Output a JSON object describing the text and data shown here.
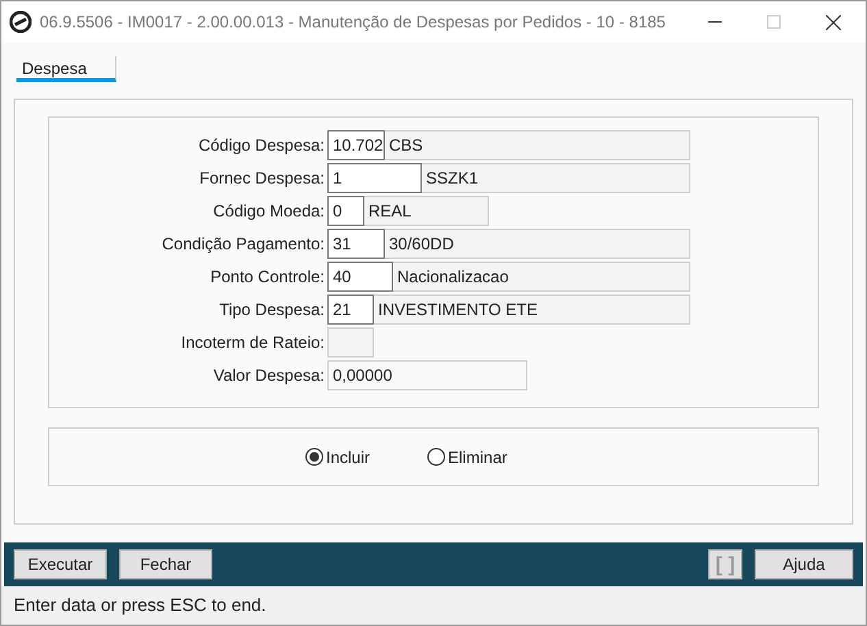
{
  "window": {
    "title": "06.9.5506 - IM0017 - 2.00.00.013 - Manutenção de Despesas por Pedidos - 10 - 8185"
  },
  "tabs": [
    {
      "label": "Despesa",
      "selected": true
    }
  ],
  "fields": [
    {
      "kind": "code_desc",
      "label": "Código Despesa:",
      "code": "10.702",
      "description": "CBS"
    },
    {
      "kind": "code_desc",
      "label": "Fornec Despesa:",
      "code": "1",
      "description": "SSZK1"
    },
    {
      "kind": "code_desc",
      "label": "Código Moeda:",
      "code": "0",
      "description": "REAL"
    },
    {
      "kind": "code_desc",
      "label": "Condição Pagamento:",
      "code": "31",
      "description": "30/60DD"
    },
    {
      "kind": "code_desc",
      "label": "Ponto Controle:",
      "code": "40",
      "description": "Nacionalizacao"
    },
    {
      "kind": "code_desc",
      "label": "Tipo Despesa:",
      "code": "21",
      "description": "INVESTIMENTO ETE"
    },
    {
      "kind": "disabled",
      "label": "Incoterm de Rateio:"
    },
    {
      "kind": "value",
      "label": "Valor Despesa:",
      "value": "0,00000"
    }
  ],
  "options": [
    {
      "label": "Incluir",
      "selected": true
    },
    {
      "label": "Eliminar",
      "selected": false
    }
  ],
  "buttons_left": [
    "Executar",
    "Fechar"
  ],
  "buttons_right": [
    {
      "label": "[ ]",
      "disabled": true
    },
    {
      "label": "Ajuda",
      "disabled": false
    }
  ],
  "status_bar": "Enter data or press ESC to end."
}
